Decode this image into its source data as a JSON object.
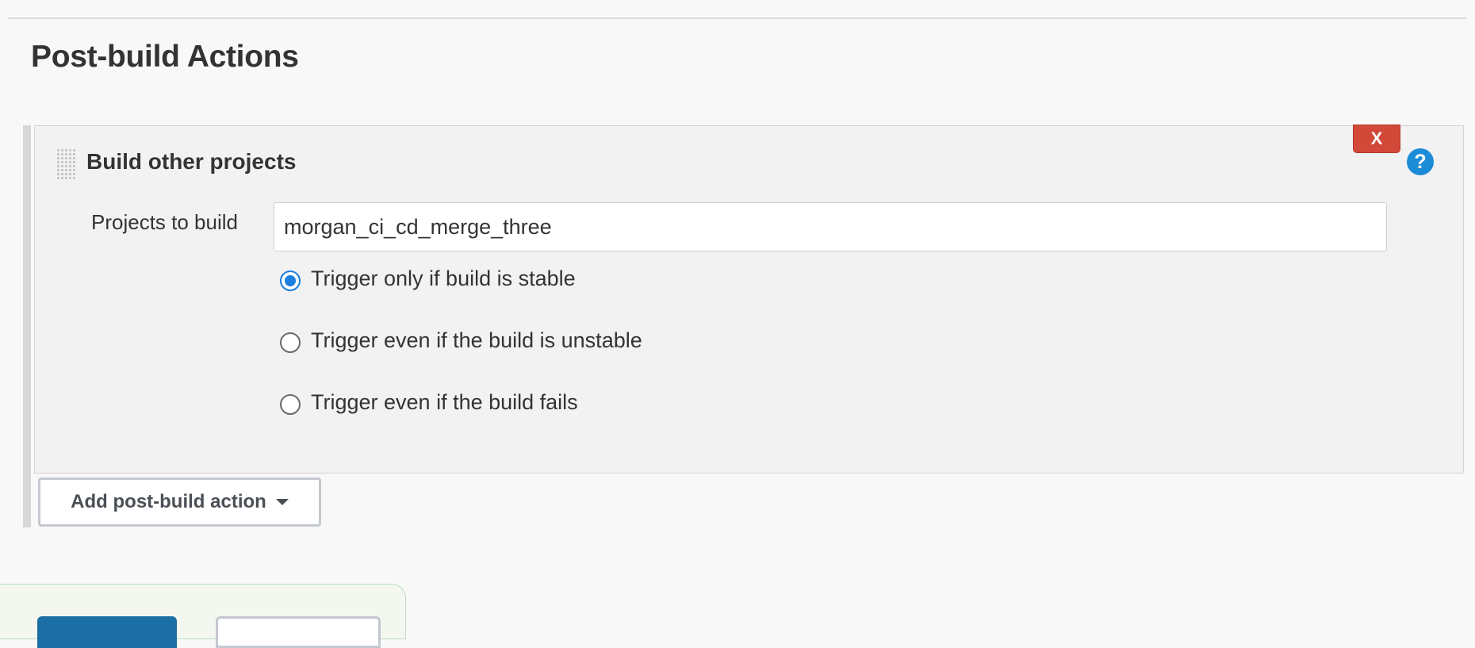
{
  "section": {
    "title": "Post-build Actions"
  },
  "panel": {
    "title": "Build other projects",
    "close_label": "X",
    "help_label": "?",
    "projects_label": "Projects to build",
    "projects_value": "morgan_ci_cd_merge_three",
    "options": [
      {
        "label": "Trigger only if build is stable",
        "checked": true
      },
      {
        "label": "Trigger even if the build is unstable",
        "checked": false
      },
      {
        "label": "Trigger even if the build fails",
        "checked": false
      }
    ]
  },
  "add_action": {
    "label": "Add post-build action",
    "icon": "caret-down-icon"
  },
  "colors": {
    "accent": "#1a7fe0",
    "danger": "#d24939",
    "help": "#1d8cd8",
    "primary_button": "#1b6fa5"
  }
}
